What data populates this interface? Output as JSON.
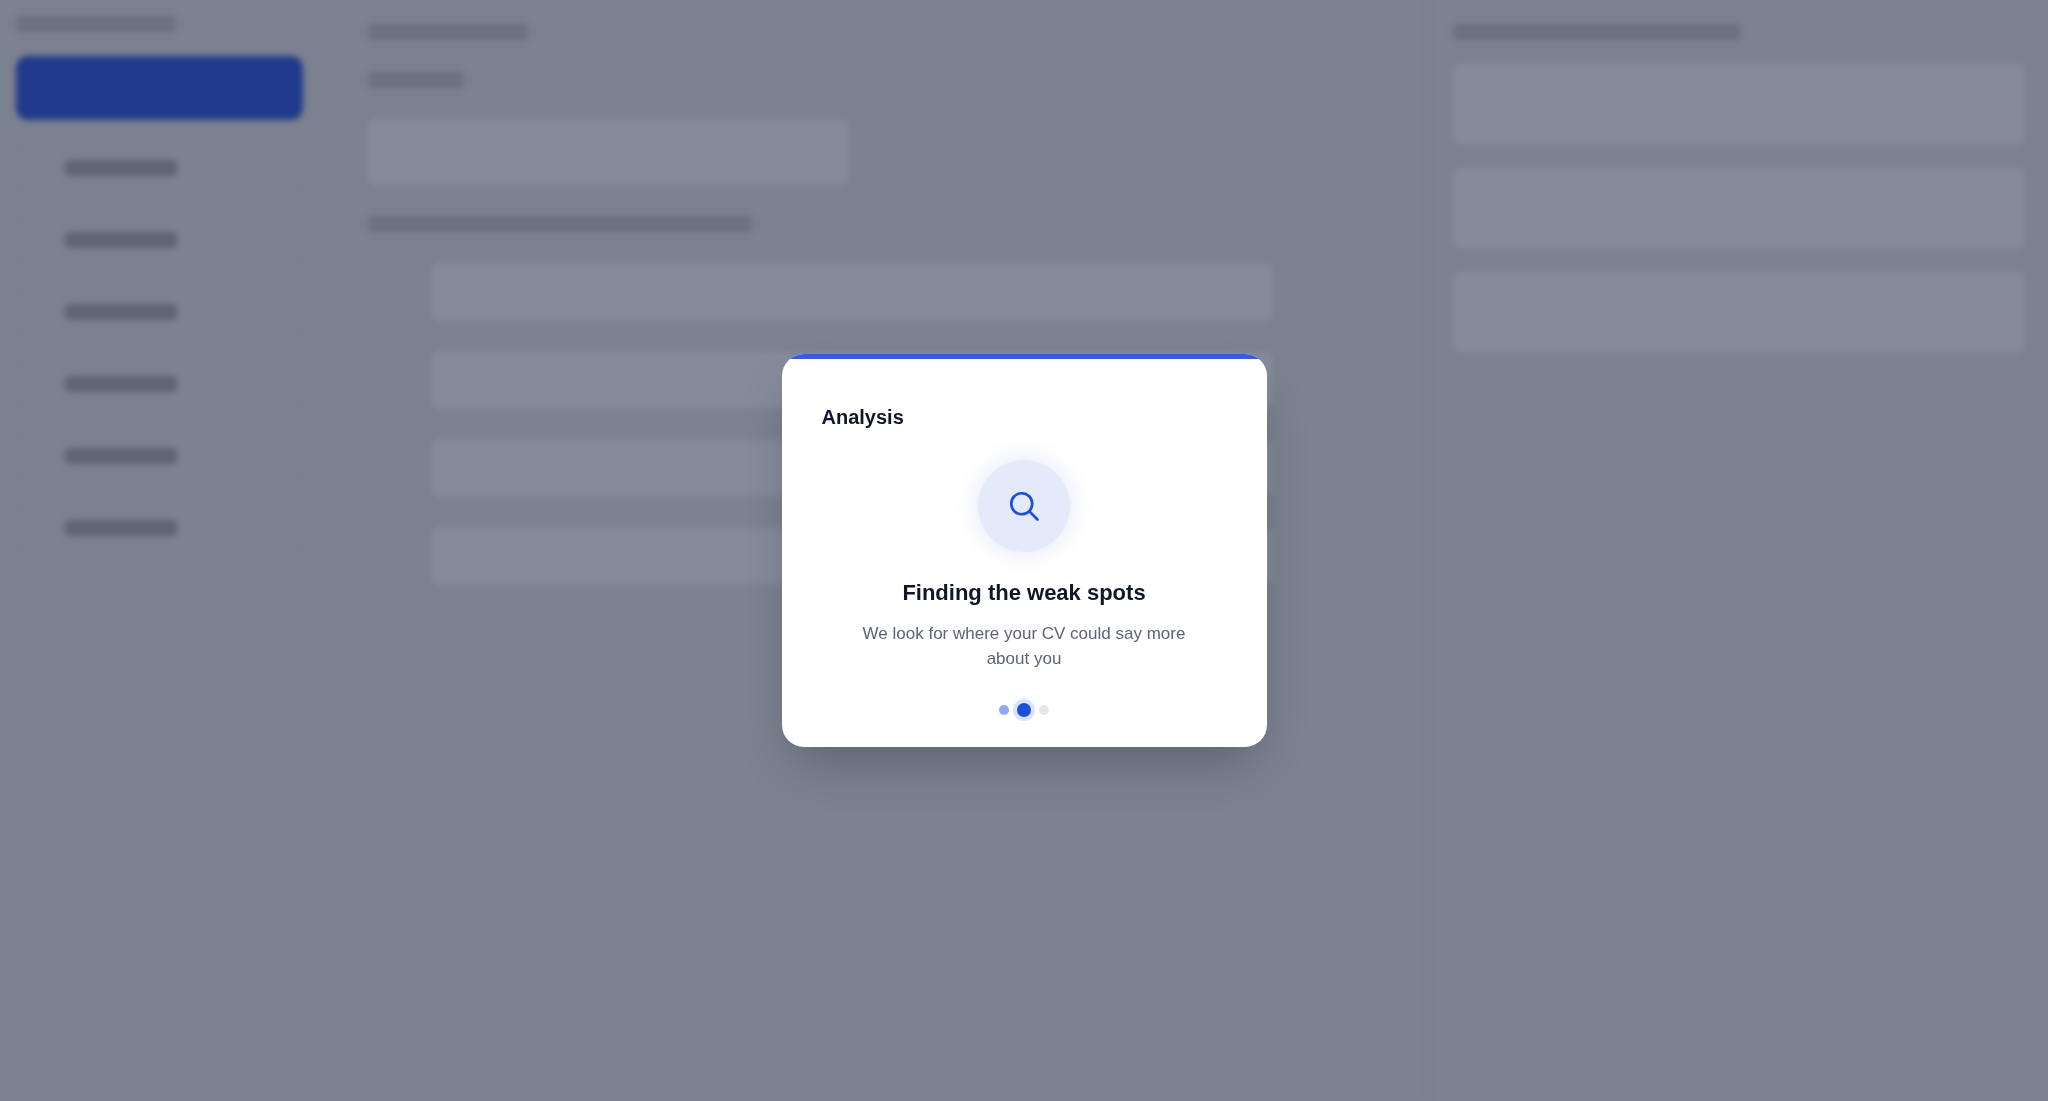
{
  "dialog": {
    "title": "Analysis",
    "heading": "Finding the weak spots",
    "description": "We look for where your CV could say more about you",
    "level": 0.99,
    "steps": [
      {
        "selected": false,
        "done": true
      },
      {
        "selected": true,
        "done": true
      },
      {
        "selected": false,
        "done": false
      }
    ]
  }
}
